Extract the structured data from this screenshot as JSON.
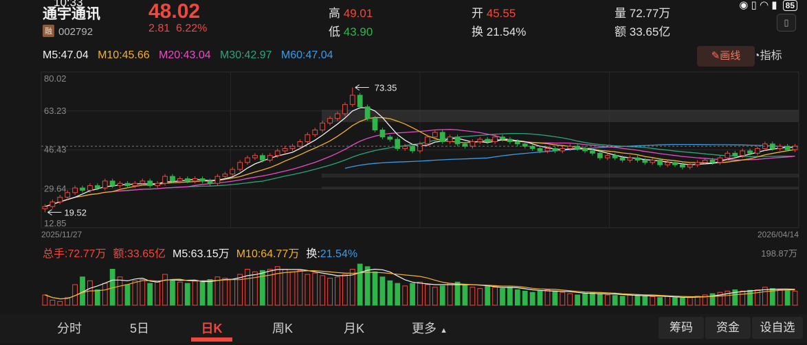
{
  "status_bar": {
    "time": "10:33",
    "battery": "85"
  },
  "stock": {
    "name": "通宇通讯",
    "margin_tag": "融",
    "code": "002792",
    "price": "48.02",
    "change": "2.81",
    "change_pct": "6.22%",
    "high_label": "高",
    "high": "49.01",
    "low_label": "低",
    "low": "43.90",
    "open_label": "开",
    "open": "45.55",
    "turnover_label": "换",
    "turnover": "21.54%",
    "volume_label": "量",
    "volume": "72.77万",
    "amount_label": "额",
    "amount": "33.65亿"
  },
  "ma": {
    "m5": "M5:47.04",
    "m10": "M10:45.66",
    "m20": "M20:43.04",
    "m30": "M30:42.97",
    "m60": "M60:47.04"
  },
  "tools": {
    "draw_label": "画线",
    "indicator_label": "指标"
  },
  "colors": {
    "up": "#f0483e",
    "down": "#2fb54a",
    "m5": "#f2f2f2",
    "m10": "#f3b229",
    "m20": "#e94cc6",
    "m30": "#27a77a",
    "m60": "#3a9be8"
  },
  "volume_info": {
    "total_label": "总手:72.77万",
    "amount_label": "额:33.65亿",
    "m5_label": "M5:63.15万",
    "m10_label": "M10:64.77万",
    "turnover_prefix": "换:",
    "turnover_value": "21.54%",
    "max_label": "198.87万"
  },
  "chart_data": {
    "type": "candlestick",
    "y_ticks": [
      "80.02",
      "63.23",
      "46.43",
      "29.64",
      "12.85"
    ],
    "ylim": [
      12.85,
      80.02
    ],
    "start_date": "2025/11/27",
    "end_date": "2026/04/14",
    "high_annotation": "73.35",
    "low_annotation": "19.52",
    "current_price": 48.02,
    "candles": [
      [
        21,
        22,
        19.5,
        23
      ],
      [
        22,
        24,
        21,
        25
      ],
      [
        24,
        26,
        23,
        27
      ],
      [
        26,
        28,
        25,
        29
      ],
      [
        28,
        30,
        27,
        31
      ],
      [
        30,
        29,
        28,
        31
      ],
      [
        29,
        31,
        28,
        32
      ],
      [
        31,
        30,
        29,
        32
      ],
      [
        30,
        33,
        29,
        34
      ],
      [
        33,
        31,
        30,
        34
      ],
      [
        31,
        32,
        30,
        33
      ],
      [
        32,
        31,
        30,
        33
      ],
      [
        31,
        32,
        30,
        33
      ],
      [
        32,
        33,
        31,
        34
      ],
      [
        33,
        31,
        30,
        34
      ],
      [
        31,
        32,
        30,
        33
      ],
      [
        32,
        35,
        31,
        36
      ],
      [
        35,
        33,
        32,
        36
      ],
      [
        33,
        34,
        32,
        35
      ],
      [
        34,
        33,
        32,
        35
      ],
      [
        33,
        34,
        32,
        35
      ],
      [
        34,
        33,
        32,
        35
      ],
      [
        33,
        32,
        31,
        34
      ],
      [
        32,
        35,
        31,
        36
      ],
      [
        35,
        36,
        34,
        37
      ],
      [
        36,
        38,
        35,
        39
      ],
      [
        38,
        41,
        37,
        42
      ],
      [
        41,
        43,
        40,
        44
      ],
      [
        43,
        44,
        42,
        45
      ],
      [
        44,
        42,
        41,
        45
      ],
      [
        42,
        44,
        41,
        45
      ],
      [
        44,
        46,
        43,
        47
      ],
      [
        46,
        47,
        45,
        48
      ],
      [
        47,
        48,
        46,
        49
      ],
      [
        48,
        50,
        47,
        51
      ],
      [
        50,
        53,
        49,
        54
      ],
      [
        53,
        55,
        52,
        56
      ],
      [
        55,
        58,
        54,
        59
      ],
      [
        58,
        60,
        57,
        61
      ],
      [
        60,
        62,
        59,
        63
      ],
      [
        62,
        66,
        61,
        67
      ],
      [
        66,
        70,
        65,
        73.35
      ],
      [
        70,
        65,
        64,
        71
      ],
      [
        65,
        60,
        59,
        66
      ],
      [
        60,
        55,
        54,
        61
      ],
      [
        55,
        52,
        51,
        56
      ],
      [
        52,
        51,
        50,
        53
      ],
      [
        51,
        47,
        46,
        52
      ],
      [
        47,
        48,
        46,
        49
      ],
      [
        48,
        46,
        45,
        49
      ],
      [
        46,
        49,
        45,
        50
      ],
      [
        49,
        52,
        48,
        53
      ],
      [
        52,
        54,
        51,
        55
      ],
      [
        54,
        50,
        49,
        55
      ],
      [
        50,
        52,
        49,
        53
      ],
      [
        52,
        49,
        48,
        53
      ],
      [
        49,
        48,
        47,
        50
      ],
      [
        48,
        50,
        47,
        51
      ],
      [
        50,
        51,
        49,
        52
      ],
      [
        51,
        50,
        49,
        52
      ],
      [
        50,
        52,
        49,
        53
      ],
      [
        52,
        51,
        50,
        53
      ],
      [
        51,
        50,
        49,
        52
      ],
      [
        50,
        49,
        48,
        51
      ],
      [
        49,
        48,
        47,
        50
      ],
      [
        48,
        47,
        46,
        49
      ],
      [
        47,
        46,
        45,
        48
      ],
      [
        46,
        47,
        45,
        48
      ],
      [
        47,
        46,
        45,
        48
      ],
      [
        46,
        47,
        45,
        48
      ],
      [
        47,
        48,
        46,
        49
      ],
      [
        48,
        47,
        46,
        49
      ],
      [
        47,
        46,
        45,
        48
      ],
      [
        46,
        45,
        44,
        47
      ],
      [
        45,
        43,
        42,
        46
      ],
      [
        43,
        44,
        42,
        45
      ],
      [
        44,
        43,
        42,
        45
      ],
      [
        43,
        42,
        41,
        44
      ],
      [
        42,
        43,
        41,
        44
      ],
      [
        43,
        42,
        41,
        44
      ],
      [
        42,
        41,
        40,
        43
      ],
      [
        41,
        42,
        40,
        43
      ],
      [
        42,
        40,
        39,
        43
      ],
      [
        40,
        41,
        39,
        42
      ],
      [
        41,
        40,
        39,
        42
      ],
      [
        40,
        39,
        38,
        41
      ],
      [
        39,
        40,
        38,
        41
      ],
      [
        40,
        41,
        39,
        42
      ],
      [
        41,
        42,
        40,
        43
      ],
      [
        42,
        41,
        40,
        43
      ],
      [
        41,
        43,
        40,
        44
      ],
      [
        43,
        45,
        42,
        46
      ],
      [
        45,
        44,
        43,
        46
      ],
      [
        44,
        46,
        43,
        47
      ],
      [
        46,
        45,
        44,
        47
      ],
      [
        45,
        47,
        44,
        48
      ],
      [
        47,
        49,
        46,
        50
      ],
      [
        49,
        47,
        46,
        50
      ],
      [
        47,
        48,
        46,
        49
      ],
      [
        48,
        46.5,
        46,
        49
      ],
      [
        46.5,
        48.02,
        45.5,
        49.01
      ]
    ],
    "volumes": [
      40,
      20,
      15,
      30,
      80,
      110,
      95,
      60,
      85,
      140,
      110,
      80,
      95,
      100,
      85,
      90,
      120,
      100,
      90,
      85,
      95,
      90,
      100,
      110,
      105,
      100,
      120,
      140,
      130,
      135,
      140,
      150,
      140,
      130,
      135,
      120,
      125,
      115,
      105,
      110,
      120,
      140,
      160,
      150,
      130,
      110,
      95,
      85,
      75,
      85,
      90,
      80,
      70,
      75,
      85,
      90,
      80,
      70,
      65,
      75,
      70,
      65,
      70,
      60,
      55,
      50,
      55,
      60,
      55,
      50,
      45,
      40,
      45,
      50,
      45,
      40,
      38,
      35,
      40,
      38,
      35,
      33,
      30,
      35,
      30,
      28,
      30,
      35,
      40,
      45,
      50,
      55,
      60,
      55,
      58,
      60,
      70,
      65,
      60,
      58,
      55
    ]
  },
  "tabs": [
    "分时",
    "5日",
    "日K",
    "周K",
    "月K",
    "更多"
  ],
  "active_tab": "日K",
  "right_buttons": [
    "筹码",
    "资金",
    "设自选"
  ]
}
